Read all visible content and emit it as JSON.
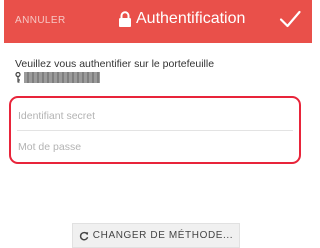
{
  "header": {
    "cancel_label": "ANNULER",
    "title": "Authentification",
    "lock_icon": "lock-icon",
    "confirm_icon": "checkmark-icon",
    "background_color": "#e9504a"
  },
  "body": {
    "message": "Veuillez vous authentifier sur le portefeuille",
    "wallet_icon": "key-icon",
    "wallet_id_redacted": true
  },
  "form": {
    "highlight_color": "#e8243a",
    "fields": [
      {
        "placeholder": "Identifiant secret",
        "value": ""
      },
      {
        "placeholder": "Mot de passe",
        "value": ""
      }
    ]
  },
  "actions": {
    "change_method_label": "CHANGER DE MÉTHODE...",
    "change_method_icon": "refresh-icon"
  }
}
